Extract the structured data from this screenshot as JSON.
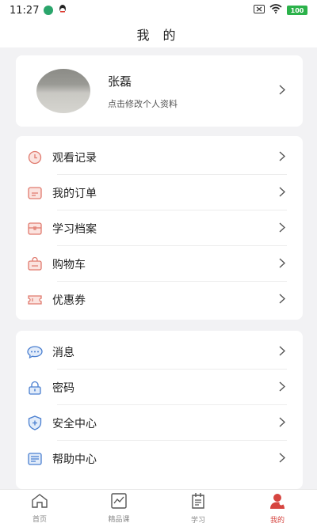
{
  "status_bar": {
    "time": "11:27",
    "battery": "100"
  },
  "header": {
    "title": "我 的"
  },
  "profile": {
    "name": "张磊",
    "subtitle": "点击修改个人资料"
  },
  "menu_group_1": [
    {
      "label": "观看记录",
      "icon": "clock-icon"
    },
    {
      "label": "我的订单",
      "icon": "order-icon"
    },
    {
      "label": "学习档案",
      "icon": "archive-icon"
    },
    {
      "label": "购物车",
      "icon": "cart-icon"
    },
    {
      "label": "优惠券",
      "icon": "coupon-icon"
    }
  ],
  "menu_group_2": [
    {
      "label": "消息",
      "icon": "message-icon"
    },
    {
      "label": "密码",
      "icon": "lock-icon"
    },
    {
      "label": "安全中心",
      "icon": "shield-icon"
    },
    {
      "label": "帮助中心",
      "icon": "help-icon"
    }
  ],
  "tab_bar": [
    {
      "label": "首页",
      "icon": "home-icon"
    },
    {
      "label": "精品课",
      "icon": "chart-icon"
    },
    {
      "label": "学习",
      "icon": "study-icon"
    },
    {
      "label": "我的",
      "icon": "profile-icon"
    }
  ],
  "colors": {
    "accent": "#d64540",
    "icon_red": "#e07a6e",
    "icon_blue": "#4a7fd0"
  }
}
